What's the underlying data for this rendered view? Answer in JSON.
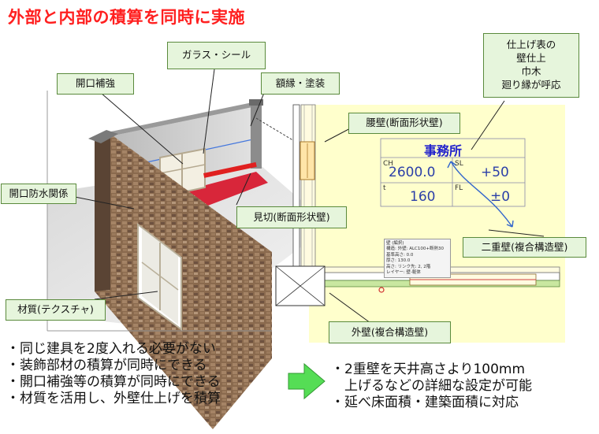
{
  "title": "外部と内部の積算を同時に実施",
  "callouts": {
    "glass_seal": "ガラス・シール",
    "opening_reinforce": "開口補強",
    "frame_paint": "額縁・塗装",
    "opening_waterproof": "開口防水関係",
    "mikiri": "見切(断面形状壁)",
    "material": "材質(テクスチャ)",
    "koshikabe": "腰壁(断面形状壁)",
    "finish_table": [
      "仕上げ表の",
      "壁仕上",
      "巾木",
      "廻り縁が呼応"
    ],
    "double_wall": "二重壁(複合構造壁)",
    "outer_wall": "外壁(複合構造壁)"
  },
  "room_tag": {
    "name": "事務所",
    "ch_label": "CH",
    "ch_value": "2600.0",
    "sl_label": "SL",
    "sl_value": "+50",
    "t_label": "t",
    "t_value": "160",
    "fl_label": "FL",
    "fl_value": "±0"
  },
  "tooltip": {
    "title": "壁 (編択)",
    "lines": [
      "構造: 外壁: ALC100+断熱30",
      "基準高さ: 0.0",
      "厚さ: 130.0",
      "高さ: リンク先: 2, 2階",
      "レイヤー: 壁-躯体"
    ]
  },
  "bullets_left": [
    "・同じ建具を2度入れる必要がない",
    "・装飾部材の積算が同時にできる",
    "・開口補強等の積算が同時にできる",
    "・材質を活用し、外壁仕上げを積算"
  ],
  "bullets_right": [
    "・2重壁を天井高さより100mm",
    "　上げるなどの詳細な設定が可能",
    "・延べ床面積・建築面積に対応"
  ],
  "colors": {
    "title": "#ff2020",
    "callout_bg": "#e6f5dc",
    "callout_border": "#5a8a3c",
    "plan_bg": "#ffffc8",
    "room_name": "#2222cc",
    "arrow": "#44cc44"
  }
}
